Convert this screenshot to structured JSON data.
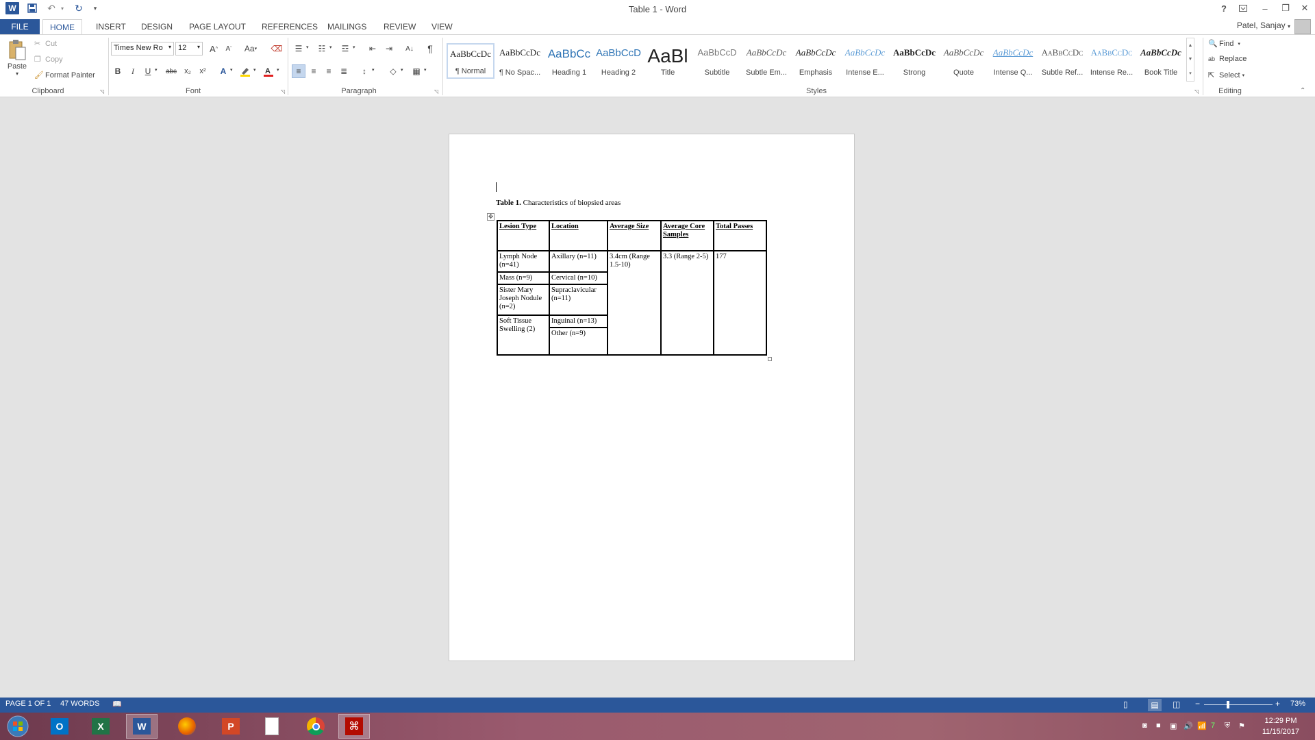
{
  "window": {
    "title": "Table 1 - Word",
    "user": "Patel, Sanjay",
    "help": "?",
    "controls": [
      "–",
      "❐",
      "✕"
    ]
  },
  "tabs": {
    "file": "FILE",
    "home": "HOME",
    "insert": "INSERT",
    "design": "DESIGN",
    "page_layout": "PAGE LAYOUT",
    "references": "REFERENCES",
    "mailings": "MAILINGS",
    "review": "REVIEW",
    "view": "VIEW"
  },
  "clipboard": {
    "label": "Clipboard",
    "paste": "Paste",
    "cut": "Cut",
    "copy": "Copy",
    "format_painter": "Format Painter"
  },
  "font": {
    "label": "Font",
    "name": "Times New Ro",
    "size": "12",
    "bold": "B",
    "italic": "I",
    "underline": "U",
    "strike": "abc",
    "sub": "x₂",
    "sup": "x²",
    "change_case": "Aa",
    "grow": "A",
    "shrink": "A"
  },
  "paragraph": {
    "label": "Paragraph"
  },
  "styles": {
    "label": "Styles",
    "items": [
      {
        "preview": "AaBbCcDc",
        "name": "¶ Normal"
      },
      {
        "preview": "AaBbCcDc",
        "name": "¶ No Spac..."
      },
      {
        "preview": "AaBbCc",
        "name": "Heading 1"
      },
      {
        "preview": "AaBbCcD",
        "name": "Heading 2"
      },
      {
        "preview": "AaBl",
        "name": "Title"
      },
      {
        "preview": "AaBbCcD",
        "name": "Subtitle"
      },
      {
        "preview": "AaBbCcDc",
        "name": "Subtle Em..."
      },
      {
        "preview": "AaBbCcDc",
        "name": "Emphasis"
      },
      {
        "preview": "AaBbCcDc",
        "name": "Intense E..."
      },
      {
        "preview": "AaBbCcDc",
        "name": "Strong"
      },
      {
        "preview": "AaBbCcDc",
        "name": "Quote"
      },
      {
        "preview": "AaBbCcDc",
        "name": "Intense Q..."
      },
      {
        "preview": "AaBbCcDc",
        "name": "Subtle Ref..."
      },
      {
        "preview": "AaBbCcDc",
        "name": "Intense Re..."
      },
      {
        "preview": "AaBbCcDc",
        "name": "Book Title"
      }
    ]
  },
  "editing": {
    "label": "Editing",
    "find": "Find",
    "replace": "Replace",
    "select": "Select"
  },
  "document": {
    "caption_bold": "Table 1.",
    "caption_text": " Characteristics of biopsied areas",
    "headers": [
      "Lesion Type",
      "Location",
      "Average Size",
      "Average Core Samples",
      "Total Passes"
    ],
    "lesion_types": [
      "Lymph Node (n=41)",
      "Mass (n=9)",
      "Sister Mary Joseph Nodule (n=2)",
      "Soft Tissue Swelling (2)"
    ],
    "locations": [
      "Axillary (n=11)",
      "Cervical (n=10)",
      "Supraclavicular (n=11)",
      "Inguinal (n=13)",
      "Other (n=9)"
    ],
    "average_size": "3.4cm (Range 1.5-10)",
    "average_core_samples": "3.3 (Range 2-5)",
    "total_passes": "177"
  },
  "status": {
    "page": "PAGE 1 OF 1",
    "words": "47 WORDS",
    "zoom": "73%",
    "zoom_fraction": 0.73
  },
  "taskbar": {
    "time": "12:29 PM",
    "date": "11/15/2017",
    "apps": [
      "outlook-icon",
      "excel-icon",
      "word-icon",
      "firefox-icon",
      "powerpoint-icon",
      "file-icon",
      "chrome-icon",
      "acrobat-icon"
    ]
  },
  "colors": {
    "accent": "#2b579a",
    "file_tab": "#2b579a",
    "status_bar": "#2b579a"
  }
}
